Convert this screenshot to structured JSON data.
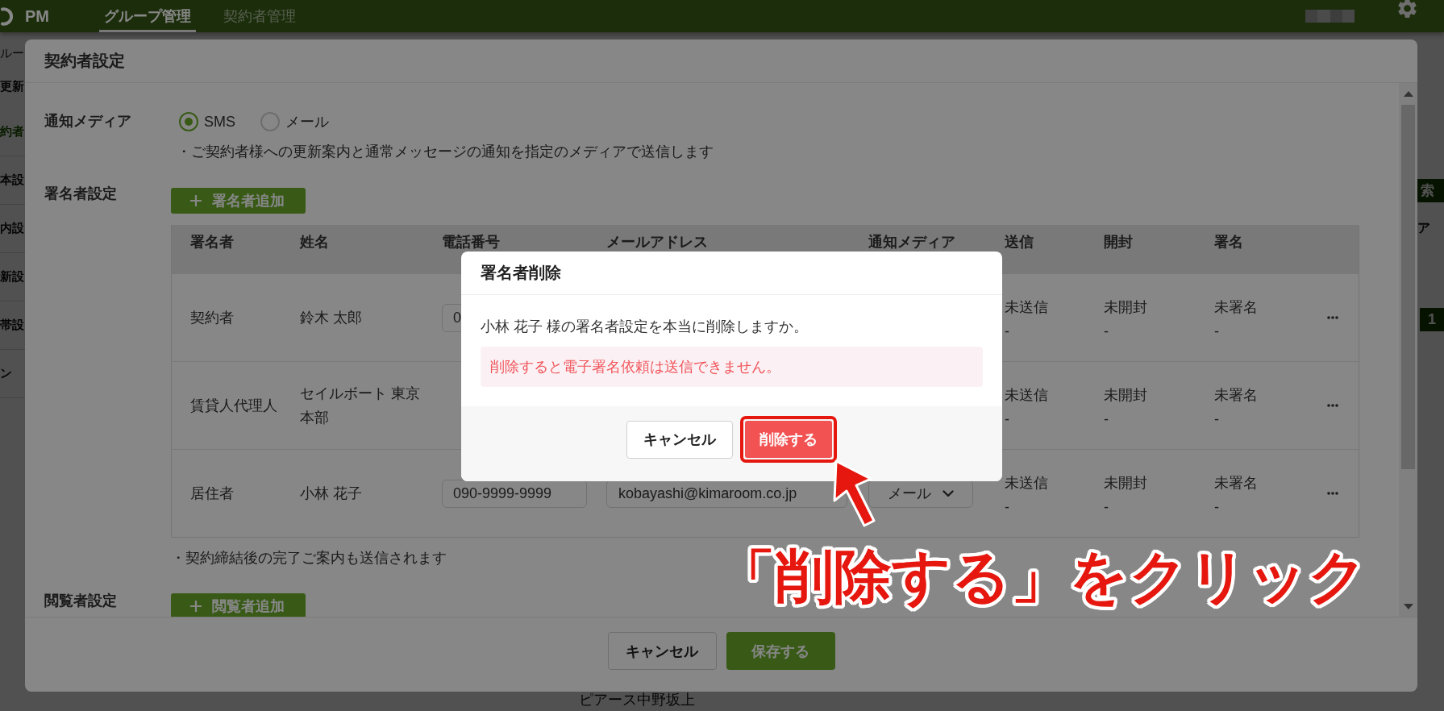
{
  "topbar": {
    "logo": "PM",
    "tabs": [
      {
        "label": "グループ管理",
        "selected": true
      },
      {
        "label": "契約者管理",
        "selected": false
      }
    ]
  },
  "page": {
    "breadcrumb": "ルー",
    "heading": "更新",
    "sidebar_items": [
      {
        "label": "約者",
        "selected": true
      },
      {
        "label": "本設",
        "selected": false
      },
      {
        "label": "内設",
        "selected": false
      },
      {
        "label": "新設",
        "selected": false
      },
      {
        "label": "帯設",
        "selected": false
      },
      {
        "label": "ン",
        "selected": false
      }
    ],
    "search_button": "索",
    "column_header": "ア",
    "pages": [
      {
        "label": "1",
        "selected": true
      }
    ],
    "row_text": "ピアース中野坂上"
  },
  "modal": {
    "title": "契約者設定",
    "notify": {
      "label": "通知メディア",
      "options": [
        {
          "label": "SMS",
          "selected": true
        },
        {
          "label": "メール",
          "selected": false
        }
      ],
      "note": "・ご契約者様への更新案内と通常メッセージの通知を指定のメディアで送信します"
    },
    "signers": {
      "label": "署名者設定",
      "add_button": "署名者追加",
      "columns": [
        "署名者",
        "姓名",
        "電話番号",
        "メールアドレス",
        "通知メディア",
        "送信",
        "開封",
        "署名"
      ],
      "rows": [
        {
          "role": "契約者",
          "name": "鈴木 太郎",
          "phone": "0",
          "send": [
            "未送信",
            "-"
          ],
          "open": [
            "未開封",
            "-"
          ],
          "sign": [
            "未署名",
            "-"
          ]
        },
        {
          "role": "賃貸人代理人",
          "name": "セイルボート 東京本部",
          "send": [
            "未送信",
            "-"
          ],
          "open": [
            "未開封",
            "-"
          ],
          "sign": [
            "未署名",
            "-"
          ]
        },
        {
          "role": "居住者",
          "name": "小林 花子",
          "phone": "090-9999-9999",
          "email": "kobayashi@kimaroom.co.jp",
          "media": "メール",
          "send": [
            "未送信",
            "-"
          ],
          "open": [
            "未開封",
            "-"
          ],
          "sign": [
            "未署名",
            "-"
          ]
        }
      ],
      "note": "・契約締結後の完了ご案内も送信されます"
    },
    "viewers": {
      "label": "閲覧者設定",
      "add_button": "閲覧者追加"
    },
    "buttons": [
      {
        "label": "キャンセル",
        "kind": "secondary"
      },
      {
        "label": "保存する",
        "kind": "primary"
      }
    ]
  },
  "dialog": {
    "title": "署名者削除",
    "message": "小林 花子 様の署名者設定を本当に削除しますか。",
    "warning": "削除すると電子署名依頼は送信できません。",
    "buttons": [
      {
        "label": "キャンセル",
        "kind": "secondary",
        "highlighted": false
      },
      {
        "label": "削除する",
        "kind": "danger",
        "highlighted": true
      }
    ]
  },
  "callout": "「削除する」をクリック"
}
